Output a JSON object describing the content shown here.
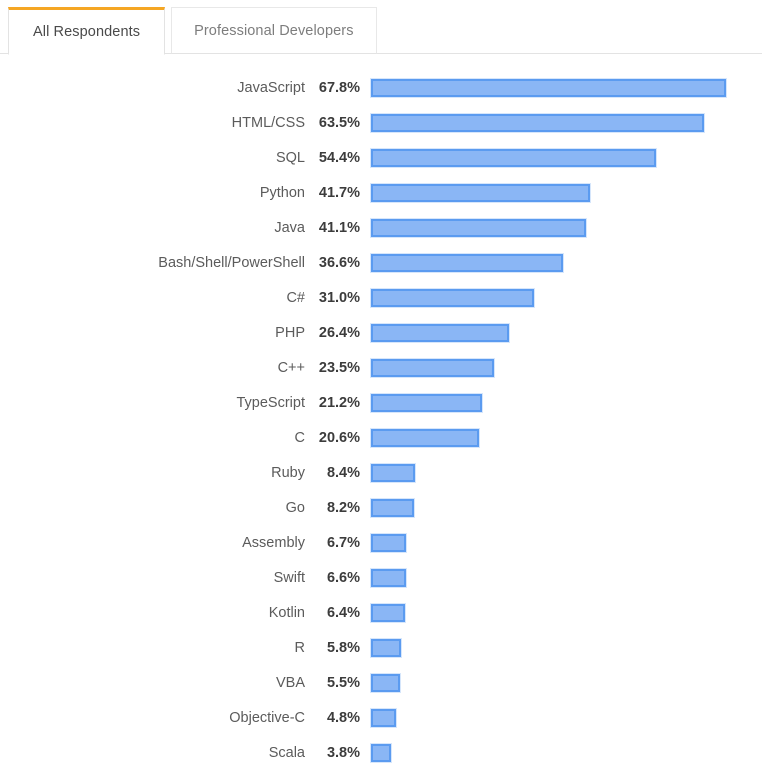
{
  "tabs": [
    {
      "label": "All Respondents",
      "active": true
    },
    {
      "label": "Professional Developers",
      "active": false
    }
  ],
  "colors": {
    "accent": "#f5a623",
    "bar_fill": "#8ab6f5",
    "bar_border": "#5b9bf0",
    "bar_halo": "#d6e6fb",
    "label_text": "#5b5b5b",
    "value_text": "#3c3c3c",
    "rule": "#e3e3e3"
  },
  "chart_data": {
    "type": "bar",
    "orientation": "horizontal",
    "title": "",
    "subtitle": "",
    "xlabel": "",
    "ylabel": "",
    "grid": false,
    "legend": "none",
    "axis_visible": false,
    "value_suffix": "%",
    "xlim": [
      0,
      70
    ],
    "categories": [
      "JavaScript",
      "HTML/CSS",
      "SQL",
      "Python",
      "Java",
      "Bash/Shell/PowerShell",
      "C#",
      "PHP",
      "C++",
      "TypeScript",
      "C",
      "Ruby",
      "Go",
      "Assembly",
      "Swift",
      "Kotlin",
      "R",
      "VBA",
      "Objective-C",
      "Scala"
    ],
    "values": [
      67.8,
      63.5,
      54.4,
      41.7,
      41.1,
      36.6,
      31.0,
      26.4,
      23.5,
      21.2,
      20.6,
      8.4,
      8.2,
      6.7,
      6.6,
      6.4,
      5.8,
      5.5,
      4.8,
      3.8
    ],
    "value_labels": [
      "67.8%",
      "63.5%",
      "54.4%",
      "41.7%",
      "41.1%",
      "36.6%",
      "31.0%",
      "26.4%",
      "23.5%",
      "21.2%",
      "20.6%",
      "8.4%",
      "8.2%",
      "6.7%",
      "6.6%",
      "6.4%",
      "5.8%",
      "5.5%",
      "4.8%",
      "3.8%"
    ]
  }
}
